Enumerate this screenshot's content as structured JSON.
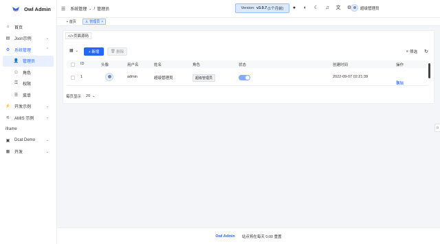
{
  "app": {
    "title": "Owl Admin",
    "version_prefix": "Version:",
    "version": "v3.9.7",
    "version_suffix": "(1个月前)"
  },
  "header": {
    "breadcrumb": {
      "parent": "系统管理",
      "separator": "/",
      "current": "管理员"
    },
    "user_name": "超级管理员",
    "icons": [
      "github-icon",
      "theme-icon",
      "moon-icon",
      "bell-icon",
      "translate-icon",
      "gear-icon"
    ]
  },
  "sidebar": {
    "items": [
      {
        "label": "首页",
        "icon": "home-icon",
        "arrow": false
      },
      {
        "label": "Json示例",
        "icon": "json-icon",
        "arrow": true
      },
      {
        "label": "系统管理",
        "icon": "system-icon",
        "arrow": true,
        "open": true
      },
      {
        "label": "管理员",
        "icon": "user-icon",
        "sub": true,
        "active": true
      },
      {
        "label": "角色",
        "icon": "role-icon",
        "sub": true
      },
      {
        "label": "权限",
        "icon": "permission-icon",
        "sub": true
      },
      {
        "label": "菜单",
        "icon": "menu-icon",
        "sub": true
      },
      {
        "label": "开发示例",
        "icon": "code-icon",
        "arrow": true
      },
      {
        "label": "AMIS 示例",
        "icon": "amis-icon",
        "arrow": true
      },
      {
        "label": "iframe",
        "icon": "",
        "arrow": false
      },
      {
        "label": "Dcat Demo",
        "icon": "dcat-icon",
        "arrow": true
      },
      {
        "label": "开发",
        "icon": "dev-icon",
        "arrow": true
      }
    ]
  },
  "tabs": [
    {
      "label": "首页",
      "icon": "home-icon"
    },
    {
      "label": "管理员",
      "icon": "user-icon",
      "active": true,
      "close": "×"
    }
  ],
  "main": {
    "source_button": "</>页面源码",
    "add_button": "+ 新增",
    "delete_button": "删除",
    "filter_button": "筛选",
    "columns": [
      "ID",
      "头像",
      "用户名",
      "姓名",
      "角色",
      "状态",
      "创建时间",
      "操作"
    ],
    "rows": [
      {
        "id": "1",
        "username": "admin",
        "name": "超级管理员",
        "role": "超级管理员",
        "status": true,
        "created": "2022-09-07 02:21:39",
        "action": "编辑"
      }
    ],
    "pager": {
      "label": "每页显示",
      "per_page": "20"
    }
  },
  "footer": {
    "brand": "Owl Admin",
    "text": "站点将在每天 0:00 重置"
  },
  "colors": {
    "accent": "#2468f2",
    "sidebar_active_bg": "#e8f0ff"
  }
}
